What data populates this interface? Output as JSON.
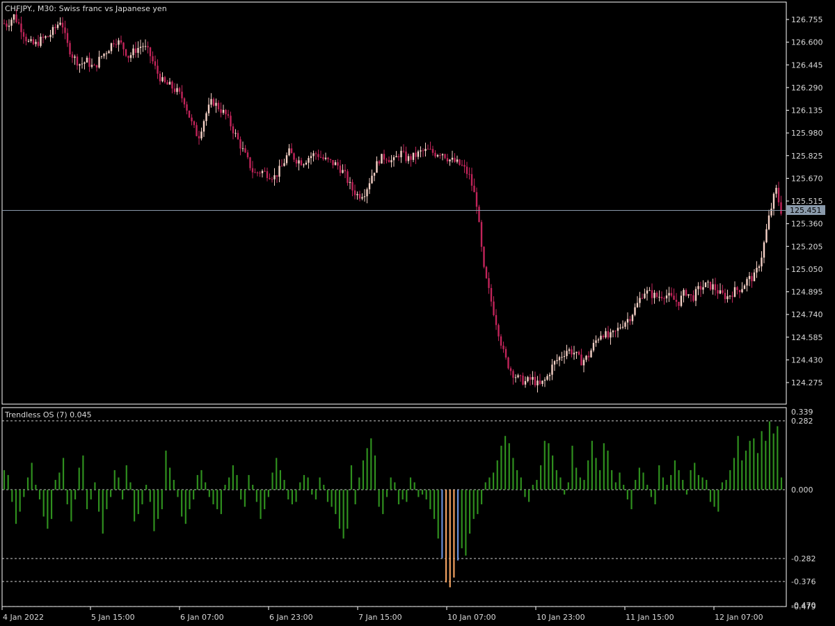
{
  "main_chart": {
    "symbol_label": "CHFJPY., M30:  Swiss franc vs Japanese yen",
    "current_price": "125.451",
    "price_ticks": [
      "126.755",
      "126.600",
      "126.445",
      "126.290",
      "126.135",
      "125.980",
      "125.825",
      "125.670",
      "125.515",
      "125.360",
      "125.205",
      "125.050",
      "124.895",
      "124.740",
      "124.585",
      "124.430",
      "124.275"
    ]
  },
  "indicator": {
    "label": "Trendless OS (7) 0.045",
    "levels": [
      "0.339",
      "0.282",
      "0.000",
      "-0.282",
      "-0.376",
      "-0.470",
      "-0.479"
    ]
  },
  "time_axis": {
    "labels": [
      "4 Jan 2022",
      "5 Jan 15:00",
      "6 Jan 07:00",
      "6 Jan 23:00",
      "7 Jan 15:00",
      "10 Jan 07:00",
      "10 Jan 23:00",
      "11 Jan 15:00",
      "12 Jan 07:00"
    ]
  },
  "colors": {
    "background": "#000000",
    "bull_candle": "#f7d2c7",
    "bear_candle": "#c2245a",
    "histogram": "#2f8f1e",
    "hist_extreme_orange": "#f0a060",
    "hist_extreme_blue": "#6a8fd8",
    "grid_line": "#ffffff",
    "price_line": "#8a9aab",
    "price_tag_bg": "#8a9aab"
  },
  "chart_data": {
    "type": "candlestick",
    "title": "CHFJPY., M30:  Swiss franc vs Japanese yen",
    "ylim": [
      124.2,
      126.83
    ],
    "close_path": [
      [
        0,
        126.74
      ],
      [
        10,
        126.72
      ],
      [
        20,
        126.78
      ],
      [
        30,
        126.7
      ],
      [
        40,
        126.6
      ],
      [
        50,
        126.58
      ],
      [
        60,
        126.62
      ],
      [
        70,
        126.64
      ],
      [
        80,
        126.7
      ],
      [
        88,
        126.76
      ],
      [
        95,
        126.6
      ],
      [
        105,
        126.5
      ],
      [
        115,
        126.45
      ],
      [
        125,
        126.47
      ],
      [
        135,
        126.42
      ],
      [
        145,
        126.5
      ],
      [
        155,
        126.55
      ],
      [
        165,
        126.62
      ],
      [
        175,
        126.58
      ],
      [
        185,
        126.5
      ],
      [
        195,
        126.55
      ],
      [
        205,
        126.58
      ],
      [
        215,
        126.52
      ],
      [
        225,
        126.4
      ],
      [
        235,
        126.32
      ],
      [
        245,
        126.3
      ],
      [
        255,
        126.26
      ],
      [
        265,
        126.2
      ],
      [
        275,
        126.05
      ],
      [
        285,
        125.95
      ],
      [
        295,
        126.1
      ],
      [
        305,
        126.2
      ],
      [
        315,
        126.15
      ],
      [
        325,
        126.1
      ],
      [
        335,
        126.0
      ],
      [
        345,
        125.9
      ],
      [
        355,
        125.8
      ],
      [
        365,
        125.7
      ],
      [
        375,
        125.72
      ],
      [
        385,
        125.7
      ],
      [
        395,
        125.68
      ],
      [
        405,
        125.75
      ],
      [
        415,
        125.85
      ],
      [
        425,
        125.8
      ],
      [
        435,
        125.78
      ],
      [
        445,
        125.82
      ],
      [
        455,
        125.84
      ],
      [
        465,
        125.8
      ],
      [
        475,
        125.78
      ],
      [
        485,
        125.76
      ],
      [
        495,
        125.7
      ],
      [
        505,
        125.6
      ],
      [
        515,
        125.55
      ],
      [
        525,
        125.58
      ],
      [
        535,
        125.7
      ],
      [
        545,
        125.8
      ],
      [
        555,
        125.82
      ],
      [
        565,
        125.78
      ],
      [
        575,
        125.85
      ],
      [
        585,
        125.8
      ],
      [
        595,
        125.82
      ],
      [
        605,
        125.85
      ],
      [
        615,
        125.86
      ],
      [
        625,
        125.84
      ],
      [
        635,
        125.85
      ],
      [
        645,
        125.8
      ],
      [
        655,
        125.78
      ],
      [
        665,
        125.75
      ],
      [
        675,
        125.68
      ],
      [
        685,
        125.5
      ],
      [
        695,
        125.05
      ],
      [
        705,
        124.85
      ],
      [
        715,
        124.65
      ],
      [
        725,
        124.45
      ],
      [
        735,
        124.35
      ],
      [
        745,
        124.3
      ],
      [
        755,
        124.28
      ],
      [
        765,
        124.3
      ],
      [
        775,
        124.25
      ],
      [
        785,
        124.3
      ],
      [
        795,
        124.4
      ],
      [
        805,
        124.45
      ],
      [
        815,
        124.5
      ],
      [
        825,
        124.48
      ],
      [
        835,
        124.42
      ],
      [
        845,
        124.45
      ],
      [
        855,
        124.55
      ],
      [
        865,
        124.62
      ],
      [
        875,
        124.58
      ],
      [
        885,
        124.62
      ],
      [
        895,
        124.68
      ],
      [
        905,
        124.72
      ],
      [
        915,
        124.8
      ],
      [
        925,
        124.9
      ],
      [
        935,
        124.88
      ],
      [
        945,
        124.86
      ],
      [
        955,
        124.88
      ],
      [
        965,
        124.85
      ],
      [
        975,
        124.82
      ],
      [
        985,
        124.9
      ],
      [
        995,
        124.85
      ],
      [
        1005,
        124.92
      ],
      [
        1015,
        124.94
      ],
      [
        1025,
        124.93
      ],
      [
        1035,
        124.88
      ],
      [
        1045,
        124.86
      ],
      [
        1055,
        124.9
      ],
      [
        1065,
        124.92
      ],
      [
        1075,
        124.98
      ],
      [
        1085,
        125.0
      ],
      [
        1095,
        125.15
      ],
      [
        1105,
        125.4
      ],
      [
        1115,
        125.6
      ],
      [
        1122,
        125.45
      ]
    ],
    "price_ticks": [
      126.755,
      126.6,
      126.445,
      126.29,
      126.135,
      125.98,
      125.825,
      125.67,
      125.515,
      125.36,
      125.205,
      125.05,
      124.895,
      124.74,
      124.585,
      124.43,
      124.275
    ],
    "indicator_series": {
      "name": "Trendless OS (7) 0.045",
      "ylim": [
        -0.479,
        0.339
      ],
      "levels": [
        0.339,
        0.282,
        0.0,
        -0.282,
        -0.376,
        -0.479
      ],
      "values": [
        0.08,
        0.06,
        -0.05,
        -0.14,
        -0.09,
        -0.03,
        0.05,
        0.11,
        0.02,
        -0.04,
        -0.11,
        -0.16,
        -0.12,
        0.04,
        0.07,
        0.13,
        -0.06,
        -0.13,
        -0.04,
        0.09,
        0.14,
        -0.08,
        -0.04,
        0.03,
        -0.09,
        -0.18,
        -0.08,
        -0.03,
        0.08,
        0.05,
        -0.04,
        0.1,
        0.03,
        -0.13,
        -0.1,
        -0.06,
        0.02,
        -0.05,
        -0.17,
        -0.12,
        -0.08,
        0.16,
        0.09,
        0.04,
        -0.03,
        -0.11,
        -0.14,
        -0.08,
        -0.04,
        0.06,
        0.08,
        0.03,
        -0.03,
        -0.06,
        -0.08,
        -0.1,
        0.02,
        0.05,
        0.1,
        0.06,
        -0.04,
        -0.07,
        0.06,
        0.02,
        -0.05,
        -0.12,
        -0.08,
        -0.03,
        0.07,
        0.13,
        0.08,
        0.04,
        -0.04,
        -0.06,
        -0.05,
        0.03,
        0.06,
        0.05,
        -0.02,
        -0.04,
        0.05,
        0.02,
        -0.05,
        -0.07,
        -0.1,
        -0.16,
        -0.2,
        -0.16,
        0.1,
        -0.06,
        0.05,
        0.12,
        0.17,
        0.21,
        0.14,
        -0.07,
        -0.1,
        -0.03,
        0.05,
        0.03,
        -0.06,
        -0.04,
        -0.05,
        0.05,
        0.03,
        -0.03,
        -0.02,
        -0.04,
        -0.08,
        -0.12,
        -0.2,
        -0.28,
        -0.38,
        -0.4,
        -0.36,
        -0.29,
        -0.24,
        -0.27,
        -0.18,
        -0.12,
        -0.1,
        -0.06,
        0.03,
        0.05,
        0.07,
        0.12,
        0.18,
        0.22,
        0.19,
        0.13,
        0.08,
        0.05,
        -0.03,
        -0.05,
        0.02,
        0.04,
        0.1,
        0.2,
        0.19,
        0.14,
        0.08,
        0.05,
        -0.02,
        0.03,
        0.18,
        0.09,
        0.05,
        0.04,
        0.12,
        0.2,
        0.13,
        0.08,
        0.19,
        0.16,
        0.08,
        0.03,
        0.07,
        0.02,
        -0.04,
        -0.08,
        0.04,
        0.09,
        0.07,
        0.02,
        -0.03,
        -0.06,
        0.1,
        0.05,
        0.02,
        0.06,
        0.12,
        0.08,
        0.04,
        -0.02,
        0.08,
        0.11,
        0.06,
        0.05,
        0.04,
        -0.05,
        -0.07,
        -0.09,
        0.03,
        0.04,
        0.08,
        0.13,
        0.22,
        0.12,
        0.16,
        0.2,
        0.21,
        0.15,
        0.24,
        0.2,
        0.28,
        0.23,
        0.26,
        0.05
      ],
      "extreme_orange_index": [
        112,
        113,
        114
      ],
      "extreme_blue_index": [
        111,
        115
      ]
    }
  }
}
